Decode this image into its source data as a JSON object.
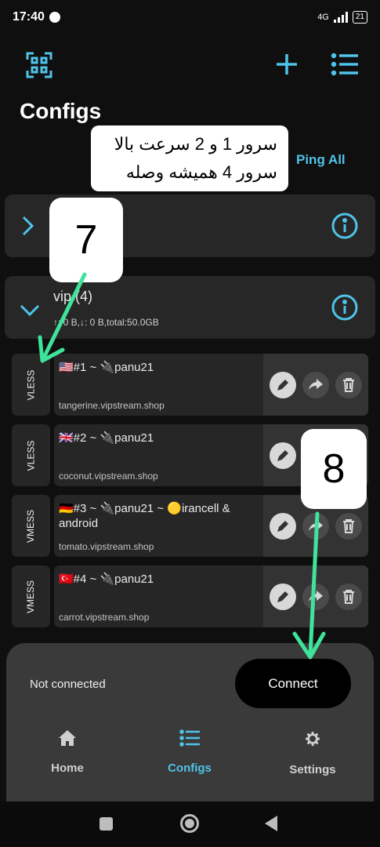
{
  "status": {
    "time": "17:40",
    "network": "4G",
    "battery": "21"
  },
  "header": {
    "title": "Configs",
    "ping_all": "Ping All"
  },
  "callout": {
    "line1": "سرور 1 و 2 سرعت بالا",
    "line2": "سرور 4 همیشه وصله"
  },
  "annotations": {
    "step7": "7",
    "step8": "8"
  },
  "groups": [
    {
      "name": "",
      "stats": ""
    },
    {
      "name": "vip (4)",
      "stats": "↑: 0 B,↓: 0 B,total:50.0GB"
    }
  ],
  "configs": [
    {
      "protocol": "VLESS",
      "name": "🇺🇸#1 ~ 🔌panu21",
      "host": "tangerine.vipstream.shop"
    },
    {
      "protocol": "VLESS",
      "name": "🇬🇧#2 ~ 🔌panu21",
      "host": "coconut.vipstream.shop"
    },
    {
      "protocol": "VMESS",
      "name": "🇩🇪#3 ~ 🔌panu21 ~ 🟡irancell & android",
      "host": "tomato.vipstream.shop"
    },
    {
      "protocol": "VMESS",
      "name": "🇹🇷#4 ~ 🔌panu21",
      "host": "carrot.vipstream.shop"
    }
  ],
  "connection": {
    "status": "Not connected",
    "button": "Connect"
  },
  "nav": {
    "home": "Home",
    "configs": "Configs",
    "settings": "Settings",
    "active": "configs"
  },
  "colors": {
    "accent": "#4fc3e8",
    "annotation_arrow": "#3fe39a",
    "background": "#0f0f0f"
  }
}
